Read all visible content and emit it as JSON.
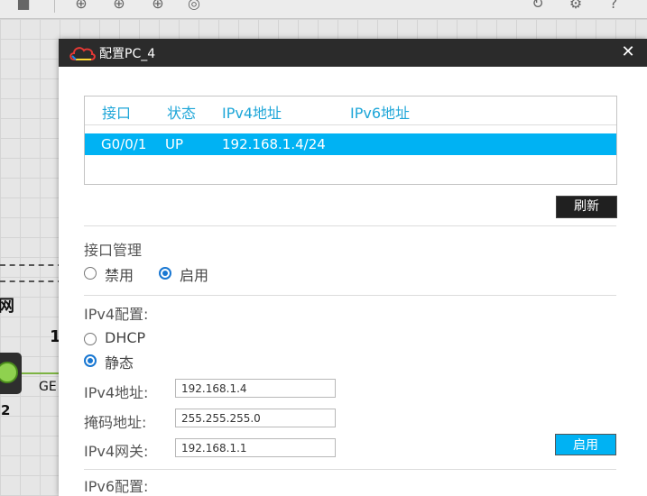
{
  "dialog": {
    "title": "配置PC_4",
    "close_symbol": "✕"
  },
  "interface_table": {
    "headers": [
      "接口",
      "状态",
      "IPv4地址",
      "IPv6地址"
    ],
    "rows": [
      {
        "interface": "G0/0/1",
        "status": "UP",
        "ipv4": "192.168.1.4/24",
        "ipv6": ""
      }
    ]
  },
  "refresh_label": "刷新",
  "interface_mgmt": {
    "label": "接口管理",
    "disable_label": "禁用",
    "enable_label": "启用",
    "selected": "enable"
  },
  "ipv4_config": {
    "label": "IPv4配置:",
    "dhcp_label": "DHCP",
    "static_label": "静态",
    "selected": "static",
    "address_label": "IPv4地址:",
    "address_value": "192.168.1.4",
    "mask_label": "掩码地址:",
    "mask_value": "255.255.255.0",
    "gateway_label": "IPv4网关:",
    "gateway_value": "192.168.1.1",
    "apply_label": "启用"
  },
  "ipv6_config": {
    "label": "IPv6配置:"
  },
  "background": {
    "text_1": "网",
    "text_2": "1",
    "text_3": "GE",
    "text_4": "2"
  },
  "colors": {
    "accent": "#00b2f3",
    "header_text": "#1ea6d8",
    "titlebar": "#2b2b2b",
    "radio_checked": "#1877d2"
  }
}
